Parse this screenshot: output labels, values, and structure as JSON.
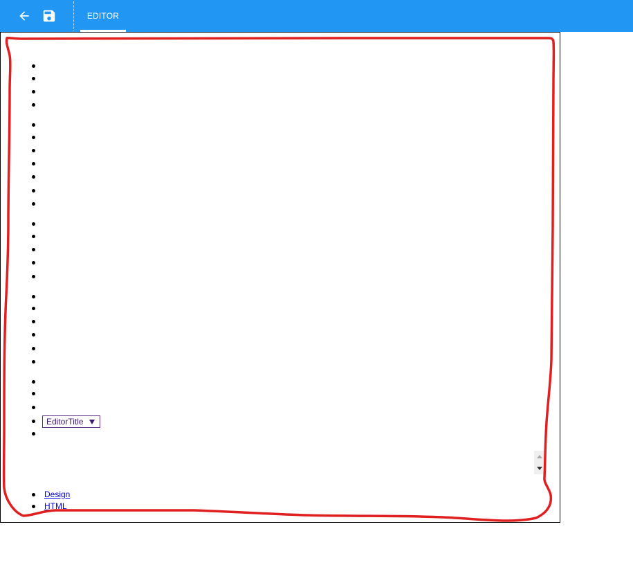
{
  "toolbar": {
    "back_icon": "arrow-left-icon",
    "save_icon": "floppy-disk-icon",
    "accent_color": "#2196f3"
  },
  "tabs": [
    {
      "label": "EDITOR",
      "active": true
    }
  ],
  "editor": {
    "dropdown": {
      "selected": "EditorTitle"
    },
    "links": [
      {
        "label": "Design"
      },
      {
        "label": "HTML"
      }
    ],
    "annotation_color": "#e02020"
  }
}
